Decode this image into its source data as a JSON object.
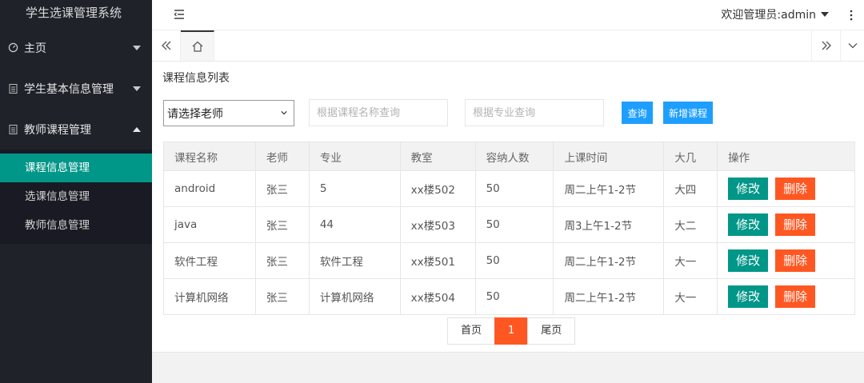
{
  "app": {
    "title": "学生选课管理系统"
  },
  "sidebar": {
    "menus": [
      {
        "label": "主页",
        "icon": "dashboard-icon",
        "expanded": false
      },
      {
        "label": "学生基本信息管理",
        "icon": "document-icon",
        "expanded": false
      },
      {
        "label": "教师课程管理",
        "icon": "document-icon",
        "expanded": true
      }
    ],
    "submenu": [
      {
        "label": "课程信息管理",
        "active": true
      },
      {
        "label": "选课信息管理",
        "active": false
      },
      {
        "label": "教师信息管理",
        "active": false
      }
    ]
  },
  "header": {
    "welcome": "欢迎管理员:admin"
  },
  "panel": {
    "title": "课程信息列表"
  },
  "filters": {
    "teacher_select": "请选择老师",
    "course_placeholder": "根据课程名称查询",
    "major_placeholder": "根据专业查询",
    "query_label": "查询",
    "add_label": "新增课程"
  },
  "table": {
    "headers": [
      "课程名称",
      "老师",
      "专业",
      "教室",
      "容纳人数",
      "上课时间",
      "大几",
      "操作"
    ],
    "rows": [
      [
        "android",
        "张三",
        "5",
        "xx楼502",
        "50",
        "周二上午1-2节",
        "大四"
      ],
      [
        "java",
        "张三",
        "44",
        "xx楼503",
        "50",
        "周3上午1-2节",
        "大二"
      ],
      [
        "软件工程",
        "张三",
        "软件工程",
        "xx楼501",
        "50",
        "周二上午1-2节",
        "大一"
      ],
      [
        "计算机网络",
        "张三",
        "计算机网络",
        "xx楼504",
        "50",
        "周二上午1-2节",
        "大一"
      ]
    ],
    "edit_label": "修改",
    "delete_label": "删除"
  },
  "pager": {
    "first": "首页",
    "current": "1",
    "last": "尾页"
  },
  "colors": {
    "sidebar": "#20222a",
    "active": "#009688",
    "primary": "#1e9fff",
    "danger": "#ff5722"
  }
}
